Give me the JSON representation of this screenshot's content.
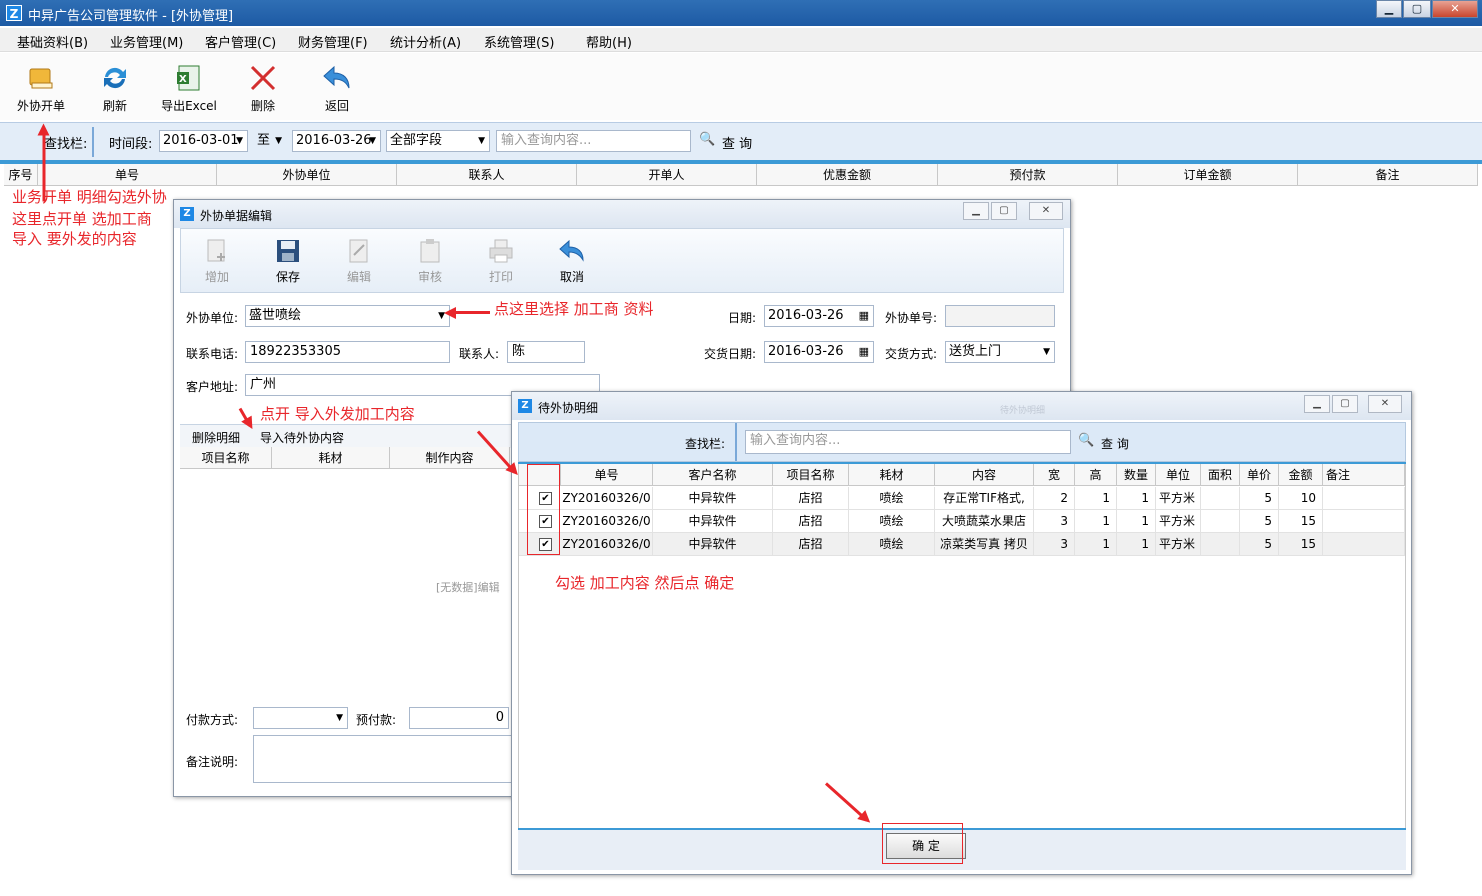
{
  "window": {
    "title": "中异广告公司管理软件 - [外协管理]",
    "icon": "Z",
    "controls": [
      "▁",
      "▢",
      "✕"
    ]
  },
  "menu": [
    "基础资料(B)",
    "业务管理(M)",
    "客户管理(C)",
    "财务管理(F)",
    "统计分析(A)",
    "系统管理(S)",
    "帮助(H)"
  ],
  "toolbar": [
    "外协开单",
    "刷新",
    "导出Excel",
    "删除",
    "返回"
  ],
  "search": {
    "label": "查找栏:",
    "time_label": "时间段:",
    "from": "2016-03-01",
    "to_label": "至",
    "to": "2016-03-26",
    "field": "全部字段",
    "placeholder": "输入查询内容...",
    "query": "查 询"
  },
  "main_columns": [
    "序号",
    "单号",
    "外协单位",
    "联系人",
    "开单人",
    "优惠金额",
    "预付款",
    "订单金额",
    "备注"
  ],
  "notes": {
    "n1": "业务开单 明细勾选外协",
    "n2": "这里点开单 选加工商",
    "n3": "导入 要外发的内容",
    "n4": "点这里选择 加工商 资料",
    "n5": "点开 导入外发加工内容",
    "n6": "勾选 加工内容 然后点 确定"
  },
  "edit_win": {
    "title": "外协单据编辑",
    "tools": [
      "增加",
      "保存",
      "编辑",
      "审核",
      "打印",
      "取消"
    ],
    "fields": {
      "unit_label": "外协单位:",
      "unit": "盛世喷绘",
      "date_label": "日期:",
      "date": "2016-03-26",
      "no_label": "外协单号:",
      "no": "",
      "phone_label": "联系电话:",
      "phone": "18922353305",
      "contact_label": "联系人:",
      "contact": "陈",
      "deliver_label": "交货日期:",
      "deliver": "2016-03-26",
      "mode_label": "交货方式:",
      "mode": "送货上门",
      "addr_label": "客户地址:",
      "addr": "广州"
    },
    "tabs": [
      "删除明细",
      "导入待外协内容"
    ],
    "cols": [
      "项目名称",
      "耗材",
      "制作内容"
    ],
    "empty": "[无数据]编辑",
    "pay_label": "付款方式:",
    "pay": "",
    "prepay_label": "预付款:",
    "prepay": "0",
    "remark_label": "备注说明:"
  },
  "pending_win": {
    "title": "待外协明细",
    "ghost": "待外协明细",
    "search_label": "查找栏:",
    "placeholder": "输入查询内容...",
    "query": "查 询",
    "cols": [
      "单号",
      "客户名称",
      "项目名称",
      "耗材",
      "内容",
      "宽",
      "高",
      "数量",
      "单位",
      "面积",
      "单价",
      "金额",
      "备注"
    ],
    "rows": [
      [
        "ZY20160326/0",
        "中异软件",
        "店招",
        "喷绘",
        "存正常TIF格式,",
        "2",
        "1",
        "1",
        "平方米",
        "",
        "5",
        "10",
        ""
      ],
      [
        "ZY20160326/0",
        "中异软件",
        "店招",
        "喷绘",
        "大喷蔬菜水果店",
        "3",
        "1",
        "1",
        "平方米",
        "",
        "5",
        "15",
        ""
      ],
      [
        "ZY20160326/0",
        "中异软件",
        "店招",
        "喷绘",
        "凉菜类写真 拷贝",
        "3",
        "1",
        "1",
        "平方米",
        "",
        "5",
        "15",
        ""
      ]
    ],
    "ok": "确 定"
  },
  "icons": {
    "check": "✔",
    "dropdown": "▼",
    "calendar": "▦",
    "search": "🔍"
  }
}
